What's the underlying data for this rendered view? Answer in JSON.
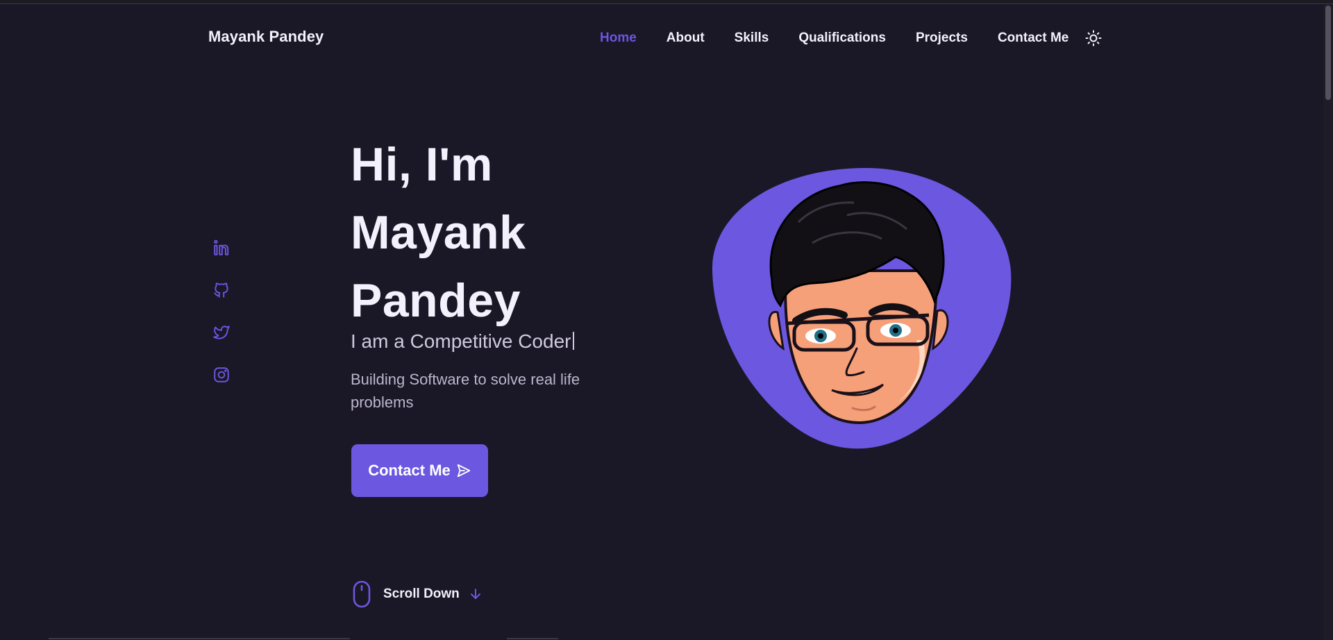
{
  "header": {
    "logo": "Mayank Pandey",
    "nav": [
      {
        "label": "Home",
        "active": true
      },
      {
        "label": "About",
        "active": false
      },
      {
        "label": "Skills",
        "active": false
      },
      {
        "label": "Qualifications",
        "active": false
      },
      {
        "label": "Projects",
        "active": false
      },
      {
        "label": "Contact Me",
        "active": false
      }
    ],
    "theme_toggle_icon": "sun-icon"
  },
  "social": [
    {
      "icon": "linkedin-icon"
    },
    {
      "icon": "github-icon"
    },
    {
      "icon": "twitter-icon"
    },
    {
      "icon": "instagram-icon"
    }
  ],
  "hero": {
    "title_lines": [
      "Hi, I'm",
      "Mayank",
      "Pandey"
    ],
    "subtitle": "I am a Competitive Coder",
    "description": "Building Software to solve real life problems",
    "cta_label": "Contact Me",
    "cta_icon": "send-icon"
  },
  "scroll_down": {
    "label": "Scroll Down",
    "icon": "mouse-icon",
    "arrow_icon": "arrow-down-icon"
  },
  "colors": {
    "background": "#1a1726",
    "accent": "#6c57e0",
    "text": "#f3f1fb",
    "muted": "#bcb7cc"
  }
}
